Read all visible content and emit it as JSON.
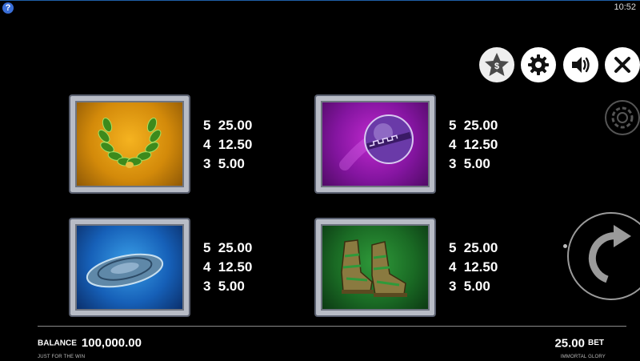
{
  "status_bar": {
    "help_label": "?",
    "clock": "10:52"
  },
  "controls": {
    "star_glyph": "$"
  },
  "paytable": [
    {
      "symbol": "laurel-wreath",
      "rows": [
        {
          "count": "5",
          "payout": "25.00"
        },
        {
          "count": "4",
          "payout": "12.50"
        },
        {
          "count": "3",
          "payout": "5.00"
        }
      ]
    },
    {
      "symbol": "purple-orb",
      "rows": [
        {
          "count": "5",
          "payout": "25.00"
        },
        {
          "count": "4",
          "payout": "12.50"
        },
        {
          "count": "3",
          "payout": "5.00"
        }
      ]
    },
    {
      "symbol": "discus",
      "rows": [
        {
          "count": "5",
          "payout": "25.00"
        },
        {
          "count": "4",
          "payout": "12.50"
        },
        {
          "count": "3",
          "payout": "5.00"
        }
      ]
    },
    {
      "symbol": "sandals",
      "rows": [
        {
          "count": "5",
          "payout": "25.00"
        },
        {
          "count": "4",
          "payout": "12.50"
        },
        {
          "count": "3",
          "payout": "5.00"
        }
      ]
    }
  ],
  "footer": {
    "balance_label": "BALANCE",
    "balance_value": "100,000.00",
    "mode_text": "JUST FOR THE WIN",
    "bet_value": "25.00",
    "bet_label": "BET",
    "game_name": "IMMORTAL GLORY"
  },
  "colors": {
    "wreath_bg": "#d38a0a",
    "orb_bg": "#8415a0",
    "disc_bg": "#1660b8",
    "sandals_bg": "#1a6a24",
    "frame": "#b8bcc6"
  }
}
